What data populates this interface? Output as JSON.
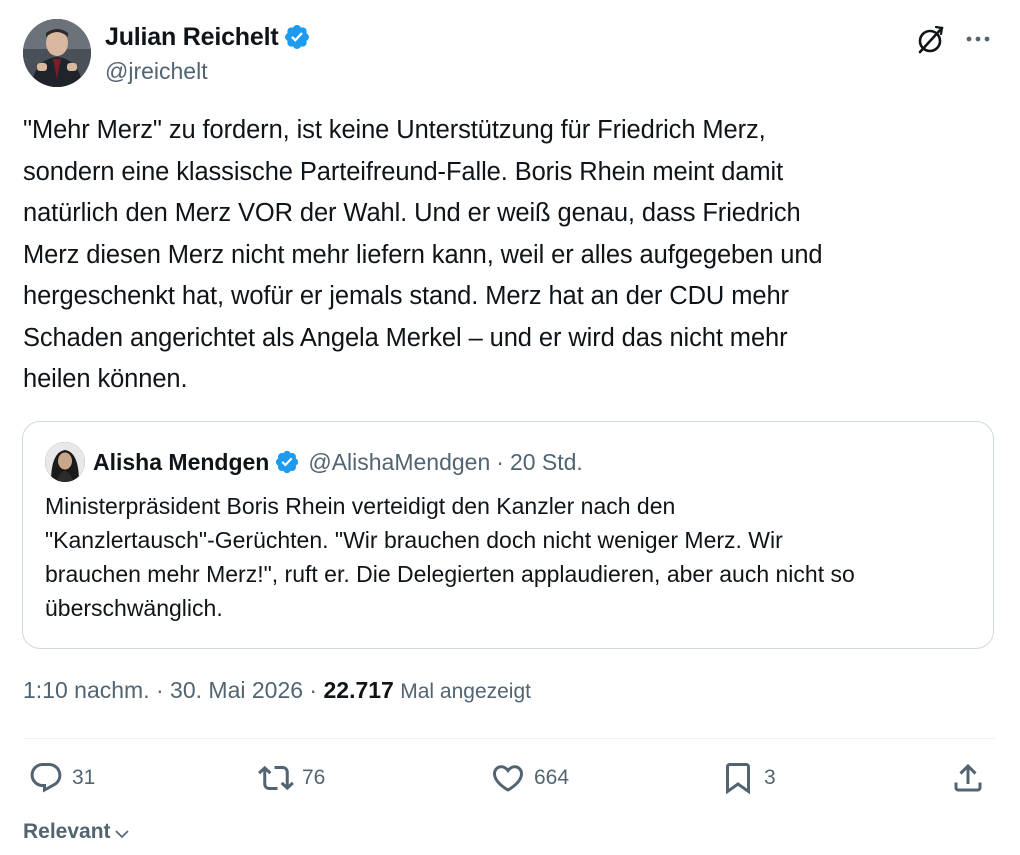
{
  "author": {
    "display_name": "Julian Reichelt",
    "handle": "@jreichelt",
    "verified": true
  },
  "tweet": {
    "text": "\"Mehr Merz\" zu fordern, ist keine Unterstützung für Friedrich Merz,\nsondern eine klassische Parteifreund-Falle. Boris Rhein meint damit\nnatürlich den Merz VOR der Wahl. Und er weiß genau, dass Friedrich\nMerz diesen Merz nicht mehr liefern kann, weil er alles aufgegeben und\nhergeschenkt hat, wofür er jemals stand. Merz hat an der CDU mehr\nSchaden angerichtet als Angela Merkel – und er wird das nicht mehr\nheilen können."
  },
  "quote": {
    "display_name": "Alisha Mendgen",
    "handle": "@AlishaMendgen",
    "separator": "·",
    "time": "20 Std.",
    "verified": true,
    "text": "Ministerpräsident Boris Rhein verteidigt den Kanzler nach den\n\"Kanzlertausch\"-Gerüchten. \"Wir brauchen doch nicht weniger Merz. Wir\nbrauchen mehr Merz!\", ruft er. Die Delegierten applaudieren, aber auch nicht so\nüberschwänglich."
  },
  "meta": {
    "time": "1:10 nachm.",
    "separator": "·",
    "date": "30. Mai 2026",
    "views_count": "22.717",
    "views_label": "Mal angezeigt"
  },
  "actions": {
    "replies": "31",
    "reposts": "76",
    "likes": "664",
    "bookmarks": "3"
  },
  "sort": {
    "label": "Relevant"
  },
  "colors": {
    "text": "#0f1419",
    "secondary": "#536471",
    "verified_blue": "#1d9bf0",
    "border": "#cfd9de"
  },
  "icons": {
    "verified": "verified-badge-icon",
    "grok": "grok-icon",
    "more": "more-icon",
    "reply": "reply-icon",
    "repost": "repost-icon",
    "like": "heart-icon",
    "bookmark": "bookmark-icon",
    "share": "share-icon",
    "chevron": "chevron-down-icon"
  }
}
